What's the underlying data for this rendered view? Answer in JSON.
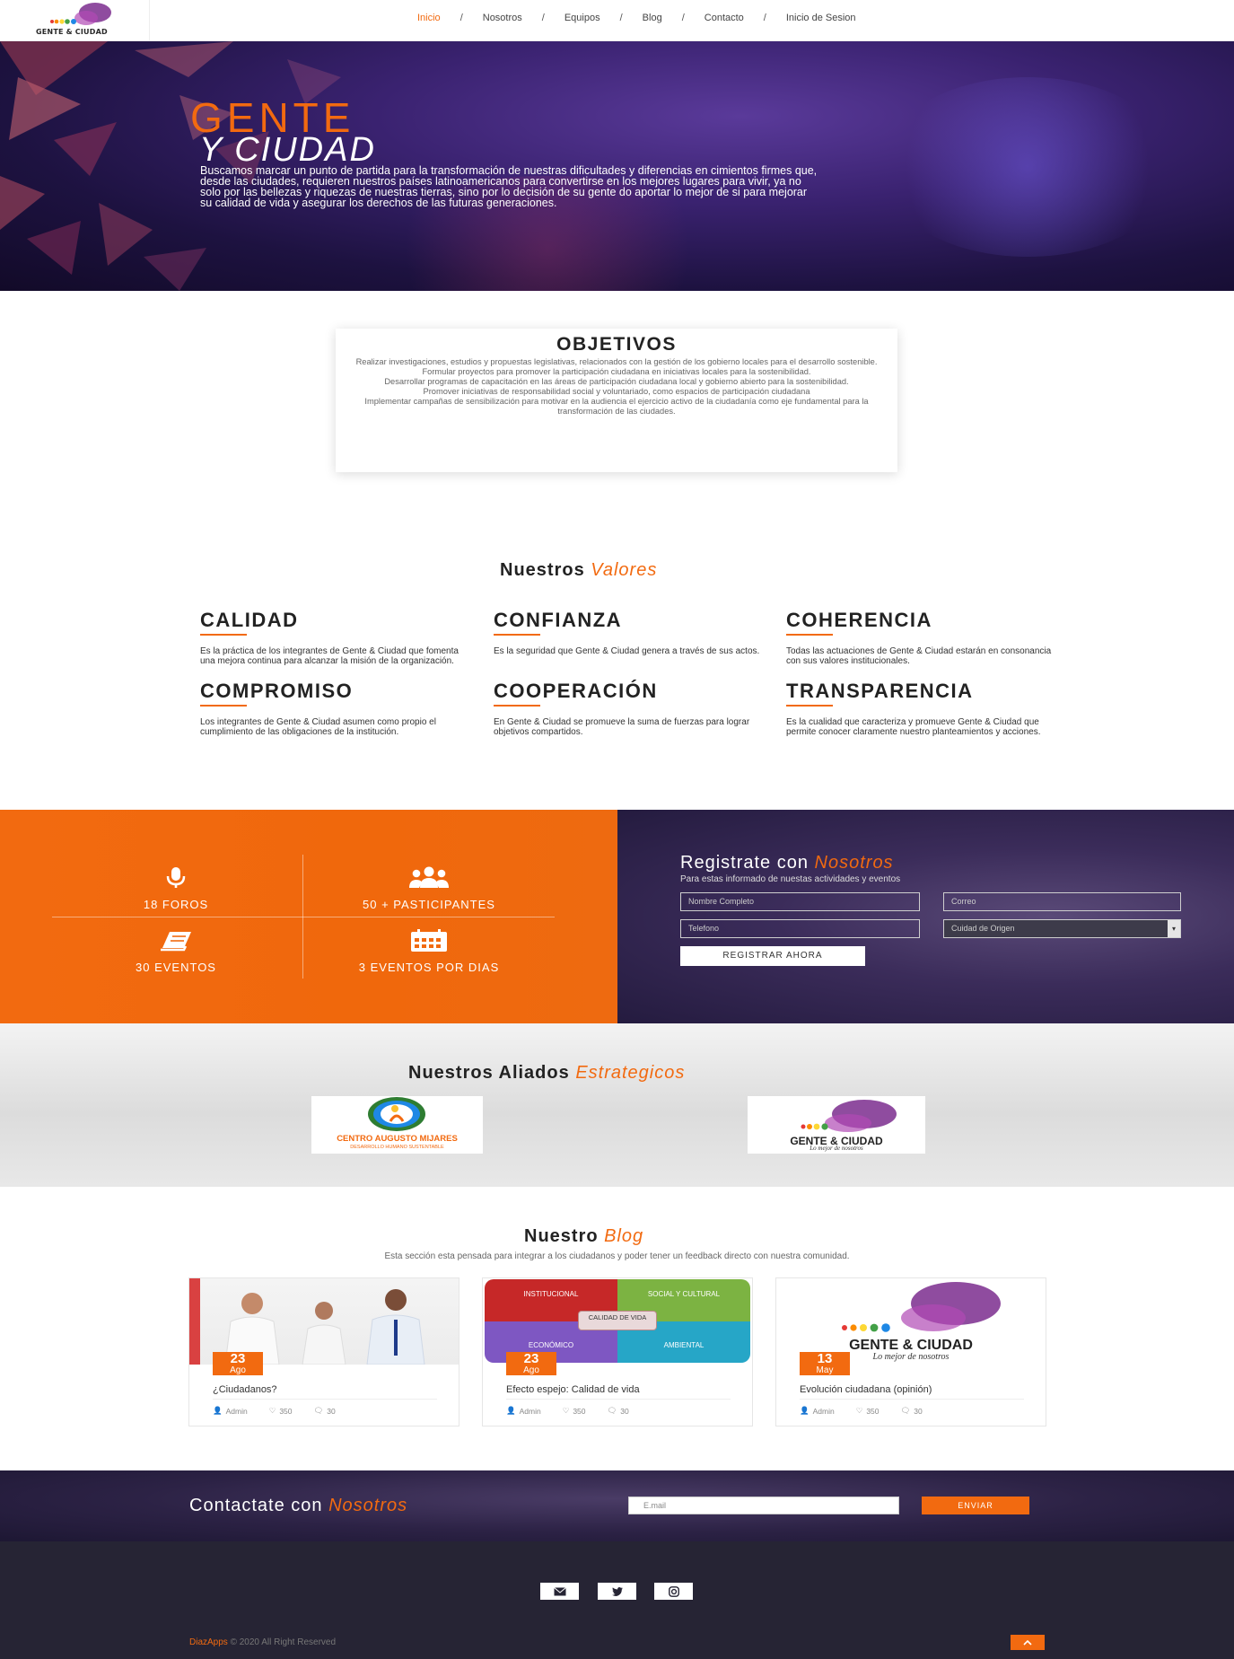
{
  "nav": {
    "logo_text": "GENTE & CIUDAD",
    "items": [
      {
        "label": "Inicio",
        "active": true
      },
      {
        "label": "Nosotros"
      },
      {
        "label": "Equipos"
      },
      {
        "label": "Blog"
      },
      {
        "label": "Contacto"
      },
      {
        "label": "Inicio de Sesion"
      }
    ],
    "separator": "/"
  },
  "hero": {
    "title_line1": "GENTE",
    "title_line2": "Y CIUDAD",
    "text": "Buscamos marcar un punto de partida para la transformación de nuestras dificultades y diferencias en cimientos firmes que, desde las ciudades, requieren nuestros países latinoamericanos para convertirse en los mejores lugares para vivir, ya no solo por las bellezas y riquezas de nuestras tierras, sino por lo decisión de su gente do aportar lo mejor de si para mejorar su calidad de vida y asegurar los derechos de las futuras generaciones."
  },
  "objetivos": {
    "title": "OBJETIVOS",
    "items": [
      "Realizar investigaciones, estudios y propuestas legislativas, relacionados con la gestión de los gobierno locales para el desarrollo sostenible.",
      "Formular proyectos para promover la participación ciudadana en iniciativas locales para la sostenibilidad.",
      "Desarrollar programas de capacitación en las áreas de participación ciudadana local y gobierno abierto para la sostenibilidad.",
      "Promover iniciativas de responsabilidad social y voluntariado, como espacios de participación ciudadana",
      "Implementar campañas de sensibilización para motivar en la audiencia el ejercicio activo de la ciudadanía como eje fundamental para la transformación de las ciudades."
    ]
  },
  "valores": {
    "title": "Nuestros",
    "title_accent": "Valores",
    "items": [
      {
        "name": "CALIDAD",
        "text": "Es la práctica de los integrantes de Gente & Ciudad que fomenta una mejora continua para alcanzar la misión de la organización."
      },
      {
        "name": "CONFIANZA",
        "text": "Es la seguridad que Gente & Ciudad genera a través de sus actos."
      },
      {
        "name": "COHERENCIA",
        "text": "Todas las actuaciones de Gente & Ciudad estarán en consonancia con sus valores institucionales."
      },
      {
        "name": "COMPROMISO",
        "text": "Los integrantes de Gente & Ciudad asumen como propio el cumplimiento de las obligaciones de la institución."
      },
      {
        "name": "COOPERACIÓN",
        "text": "En Gente & Ciudad se promueve la suma de fuerzas para lograr objetivos compartidos."
      },
      {
        "name": "TRANSPARENCIA",
        "text": "Es la cualidad que caracteriza y promueve Gente & Ciudad que permite conocer claramente nuestro planteamientos y acciones."
      }
    ]
  },
  "stats": [
    {
      "label": "18 FOROS",
      "icon": "microphone-icon"
    },
    {
      "label": "50 + PASTICIPANTES",
      "icon": "users-icon"
    },
    {
      "label": "30 EVENTOS",
      "icon": "book-icon"
    },
    {
      "label": "3 EVENTOS POR DIAS",
      "icon": "calendar-icon"
    }
  ],
  "register": {
    "title": "Registrate con",
    "title_accent": "Nosotros",
    "subtitle": "Para estas informado de nuestas actividades y eventos",
    "name_placeholder": "Nombre Completo",
    "email_placeholder": "Correo",
    "phone_placeholder": "Telefono",
    "city_select": "Cuidad de Origen",
    "button": "REGISTRAR AHORA"
  },
  "allies": {
    "title": "Nuestros Aliados",
    "title_accent": "Estrategicos",
    "items": [
      {
        "name": "CENTRO AUGUSTO MIJARES",
        "sub": "DESARROLLO HUMANO SUSTENTABLE"
      },
      {
        "name": "GENTE & CIUDAD",
        "sub": "Lo mejor de nosotros"
      }
    ]
  },
  "blog": {
    "title": "Nuestro",
    "title_accent": "Blog",
    "subtitle": "Esta sección esta pensada para integrar a los ciudadanos y poder tener un feedback directo con nuestra comunidad.",
    "posts": [
      {
        "day": "23",
        "month": "Ago",
        "title": "¿Ciudadanos?",
        "author": "Admin",
        "likes": "350",
        "comments": "30"
      },
      {
        "day": "23",
        "month": "Ago",
        "title": "Efecto espejo: Calidad de vida",
        "author": "Admin",
        "likes": "350",
        "comments": "30",
        "quad": [
          "INSTITUCIONAL",
          "SOCIAL Y CULTURAL",
          "ECONÓMICO",
          "AMBIENTAL"
        ],
        "center": "CALIDAD DE VIDA"
      },
      {
        "day": "13",
        "month": "May",
        "title": "Evolución ciudadana (opinión)",
        "author": "Admin",
        "likes": "350",
        "comments": "30",
        "logo_text": "GENTE & CIUDAD",
        "logo_sub": "Lo mejor de nosotros"
      }
    ]
  },
  "contact": {
    "title": "Contactate con",
    "title_accent": "Nosotros",
    "email_placeholder": "E.mail",
    "button": "ENVIAR"
  },
  "footer": {
    "brand": "DiazApps",
    "copyright": " © 2020 All Right Reserved"
  },
  "colors": {
    "accent": "#f26a10",
    "dark": "#262434"
  }
}
